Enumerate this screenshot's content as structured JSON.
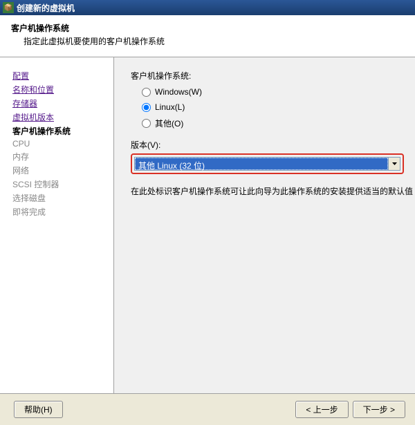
{
  "window": {
    "title": "创建新的虚拟机"
  },
  "header": {
    "title": "客户机操作系统",
    "subtitle": "指定此虚拟机要使用的客户机操作系统"
  },
  "sidebar": {
    "items": [
      {
        "label": "配置",
        "state": "visited"
      },
      {
        "label": "名称和位置",
        "state": "visited"
      },
      {
        "label": "存储器",
        "state": "visited"
      },
      {
        "label": "虚拟机版本",
        "state": "visited"
      },
      {
        "label": "客户机操作系统",
        "state": "current"
      },
      {
        "label": "CPU",
        "state": "disabled"
      },
      {
        "label": "内存",
        "state": "disabled"
      },
      {
        "label": "网络",
        "state": "disabled"
      },
      {
        "label": "SCSI 控制器",
        "state": "disabled"
      },
      {
        "label": "选择磁盘",
        "state": "disabled"
      },
      {
        "label": "即将完成",
        "state": "disabled"
      }
    ]
  },
  "main": {
    "os_label": "客户机操作系统:",
    "radios": {
      "windows": "Windows(W)",
      "linux": "Linux(L)",
      "other": "其他(O)"
    },
    "selected_os": "linux",
    "version_label": "版本(V):",
    "version_value": "其他 Linux (32 位)",
    "helper": "在此处标识客户机操作系统可让此向导为此操作系统的安装提供适当的默认值"
  },
  "footer": {
    "help": "帮助(H)",
    "back": "< 上一步",
    "next": "下一步 >"
  }
}
